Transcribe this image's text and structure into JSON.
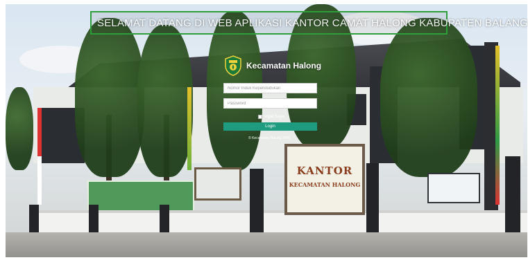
{
  "marquee": {
    "text": "SELAMAT DATANG DI WEB APLIKASI KANTOR CAMAT HALONG KABUPATEN BALANG"
  },
  "brand": {
    "name": "Kecamatan Halong",
    "logo_icon": "regency-emblem-icon"
  },
  "login_form": {
    "nik_placeholder": "Nomor Induk Kependudukan",
    "password_placeholder": "Password",
    "remember_label": "Ingat Saya",
    "submit_label": "Login"
  },
  "footer": {
    "copyright": "© Kecamatan Halong 2020"
  },
  "signboard": {
    "line1": "KANTOR",
    "line2": "KECAMATAN HALONG"
  },
  "colors": {
    "accent": "#1f9c7f",
    "marquee_border": "#2e9e3a"
  }
}
